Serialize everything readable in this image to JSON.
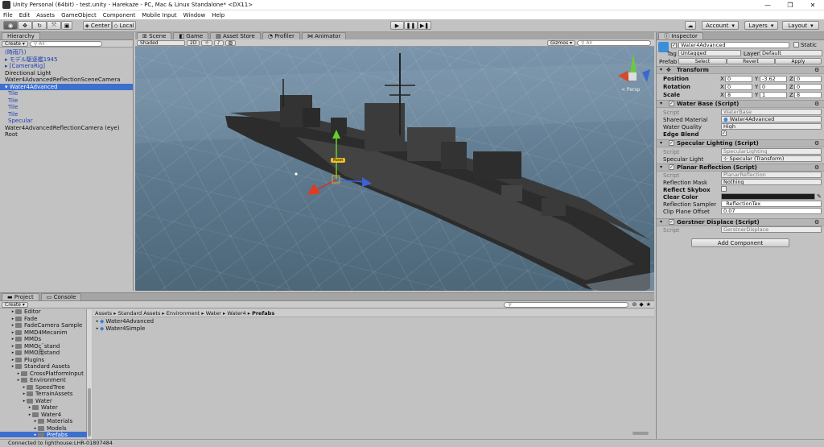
{
  "window": {
    "title": "Unity Personal (64bit) - test.unity - Harekaze - PC, Mac & Linux Standalone* <DX11>",
    "minimize": "—",
    "maximize": "❐",
    "close": "✕"
  },
  "menu": [
    "File",
    "Edit",
    "Assets",
    "GameObject",
    "Component",
    "Mobile Input",
    "Window",
    "Help"
  ],
  "toolbar": {
    "pivot_center": "Center",
    "pivot_space": "Local",
    "play": "▶",
    "pause": "❚❚",
    "step": "▶❚",
    "cloud": "☁",
    "account": "Account",
    "layers": "Layers",
    "layout": "Layout"
  },
  "hierarchy": {
    "tab": "Hierarchy",
    "create": "Create",
    "search_placeholder": "All",
    "items": [
      {
        "label": "(時雨乃)",
        "style": "blue"
      },
      {
        "label": "▸ モデル駆逐艦1945",
        "style": "blue"
      },
      {
        "label": "▸ [CameraRig]",
        "style": "blue"
      },
      {
        "label": "Directional Light",
        "style": ""
      },
      {
        "label": "Water4AdvancedReflectionSceneCamera",
        "style": ""
      },
      {
        "label": "▾ Water4Advanced",
        "style": "sel"
      },
      {
        "label": "   Tile",
        "style": "blue"
      },
      {
        "label": "   Tile",
        "style": "blue"
      },
      {
        "label": "   Tile",
        "style": "blue"
      },
      {
        "label": "   Tile",
        "style": "blue"
      },
      {
        "label": "   Specular",
        "style": "blue"
      },
      {
        "label": "Water4AdvancedReflectionCamera (eye)",
        "style": ""
      },
      {
        "label": "Root",
        "style": ""
      }
    ]
  },
  "scene": {
    "tabs": [
      "Scene",
      "Game",
      "Asset Store",
      "Profiler",
      "Animator"
    ],
    "shading": "Shaded",
    "mode_2d": "2D",
    "gizmos": "Gizmos",
    "search": "All",
    "persp": "< Persp",
    "tag": "Root"
  },
  "project": {
    "tabs": [
      "Project",
      "Console"
    ],
    "create": "Create",
    "breadcrumb": [
      "Assets",
      "Standard Assets",
      "Environment",
      "Water",
      "Water4"
    ],
    "breadcrumb_current": "Prefabs",
    "tree": [
      {
        "label": "Editor",
        "indent": 1
      },
      {
        "label": "Fade",
        "indent": 1
      },
      {
        "label": "FadeCamera Sample",
        "indent": 1
      },
      {
        "label": "MMD4Mecanim",
        "indent": 1
      },
      {
        "label": "MMDs",
        "indent": 1
      },
      {
        "label": "MMOç¨stand",
        "indent": 1
      },
      {
        "label": "MMO用stand",
        "indent": 1
      },
      {
        "label": "Plugins",
        "indent": 1
      },
      {
        "label": "Standard Assets",
        "indent": 1
      },
      {
        "label": "CrossPlatformInput",
        "indent": 2
      },
      {
        "label": "Environment",
        "indent": 2
      },
      {
        "label": "SpeedTree",
        "indent": 3
      },
      {
        "label": "TerrainAssets",
        "indent": 3
      },
      {
        "label": "Water",
        "indent": 3
      },
      {
        "label": "Water",
        "indent": 4
      },
      {
        "label": "Water4",
        "indent": 4
      },
      {
        "label": "Materials",
        "indent": 5
      },
      {
        "label": "Models",
        "indent": 5
      },
      {
        "label": "Prefabs",
        "indent": 5,
        "selected": true
      }
    ],
    "assets": [
      "Water4Advanced",
      "Water4Simple"
    ]
  },
  "inspector": {
    "tab": "Inspector",
    "name": "Water4Advanced",
    "static": "Static",
    "tag_label": "Tag",
    "tag_value": "Untagged",
    "layer_label": "Layer",
    "layer_value": "Default",
    "prefab_label": "Prefab",
    "prefab_select": "Select",
    "prefab_revert": "Revert",
    "prefab_apply": "Apply",
    "transform": {
      "title": "Transform",
      "position": "Position",
      "rotation": "Rotation",
      "scale": "Scale",
      "pos": [
        "0",
        "-3.62",
        "0"
      ],
      "rot": [
        "0",
        "0",
        "0"
      ],
      "scl": [
        "8",
        "1",
        "8"
      ],
      "axes": [
        "X",
        "Y",
        "Z"
      ]
    },
    "water_base": {
      "title": "Water Base (Script)",
      "script_label": "Script",
      "script": "WaterBase",
      "mat_label": "Shared Material",
      "mat": "Water4Advanced",
      "quality_label": "Water Quality",
      "quality": "High",
      "edge_label": "Edge Blend"
    },
    "specular": {
      "title": "Specular Lighting (Script)",
      "script_label": "Script",
      "script": "SpecularLighting",
      "light_label": "Specular Light",
      "light": "Specular (Transform)"
    },
    "planar": {
      "title": "Planar Reflection (Script)",
      "script_label": "Script",
      "script": "PlanarReflection",
      "mask_label": "Reflection Mask",
      "mask": "Nothing",
      "skybox_label": "Reflect Skybox",
      "clear_label": "Clear Color",
      "sampler_label": "Reflection Sampler",
      "sampler": "_ReflectionTex",
      "clip_label": "Clip Plane Offset",
      "clip": "0.07"
    },
    "gerstner": {
      "title": "Gerstner Displace (Script)",
      "script_label": "Script",
      "script": "GerstnerDisplace"
    },
    "add_component": "Add Component"
  },
  "status": "Connected to lighthouse:LHR-01807484"
}
